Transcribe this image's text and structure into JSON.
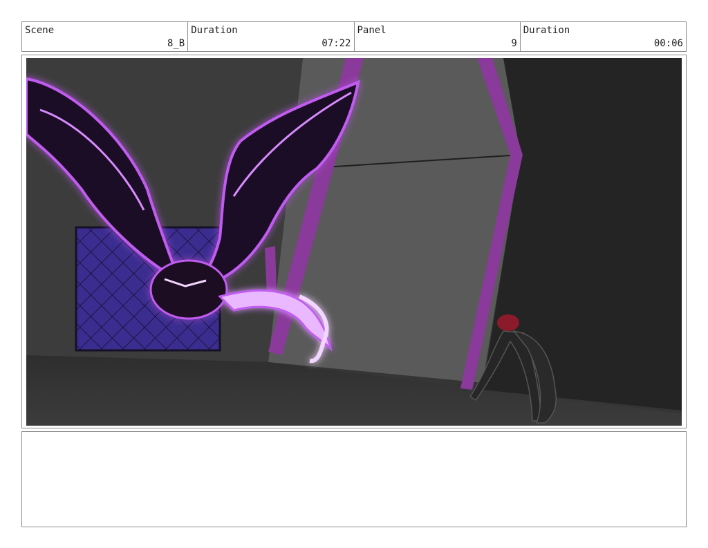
{
  "header": {
    "scene_label": "Scene",
    "scene_value": "8_B",
    "scene_duration_label": "Duration",
    "scene_duration_value": "07:22",
    "panel_label": "Panel",
    "panel_value": "9",
    "panel_duration_label": "Duration",
    "panel_duration_value": "00:06"
  },
  "notes": {
    "text": ""
  },
  "colors": {
    "glow": "#c15cf0",
    "pillar": "#8a3a9a",
    "net": "#3a2a8a",
    "helmet": "#8b1a2a"
  }
}
